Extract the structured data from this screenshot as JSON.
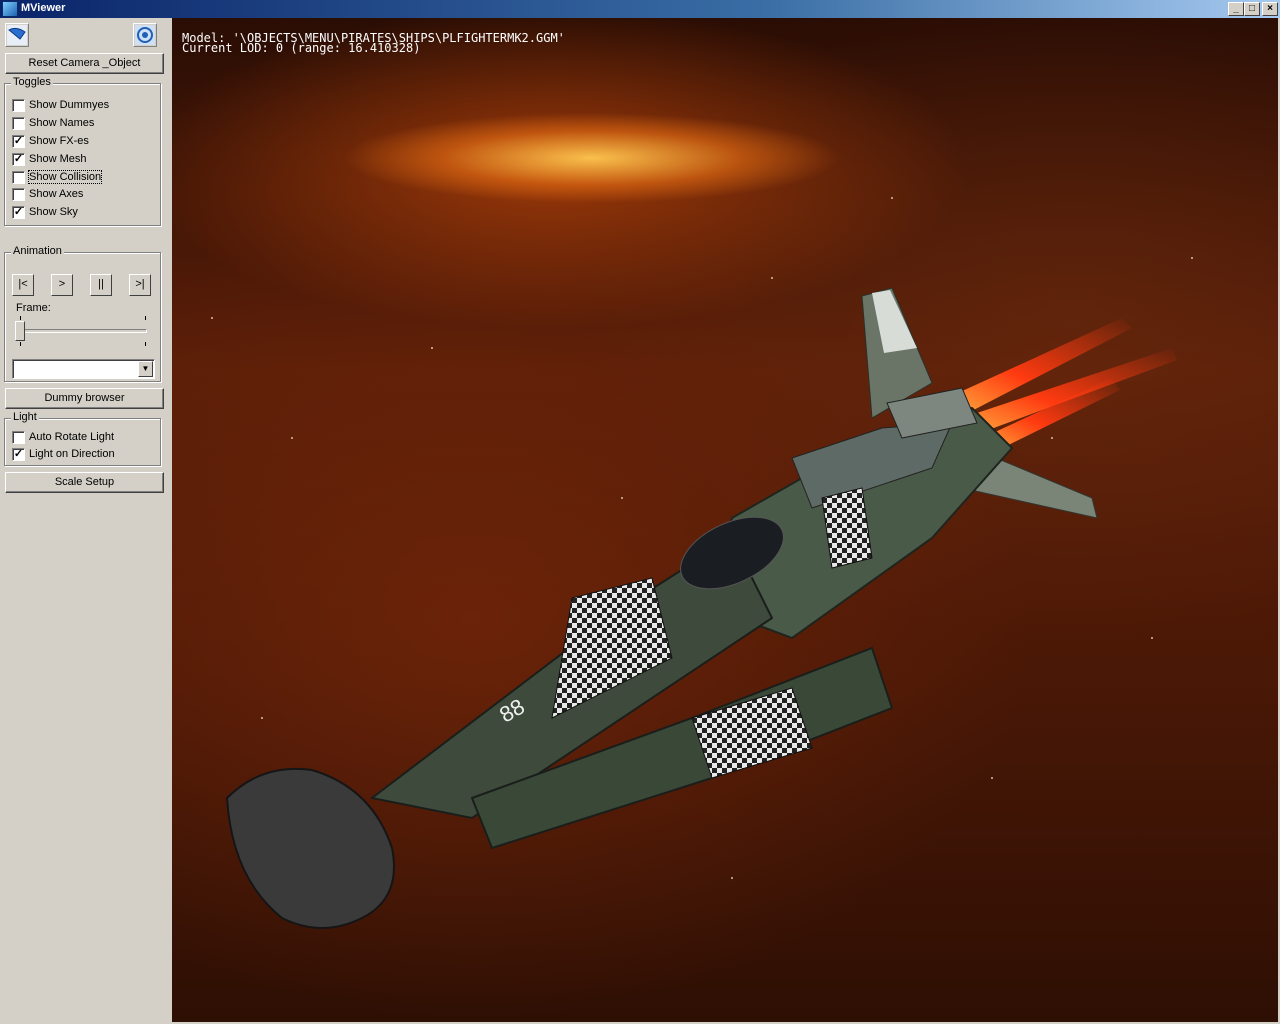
{
  "window": {
    "title": "MViewer",
    "icon": "mviewer-app-icon",
    "controls": {
      "minimize": "_",
      "maximize": "□",
      "close": "×"
    }
  },
  "toolbar": {
    "left_icon": "wing-model-icon",
    "right_icon": "camera-target-icon"
  },
  "panel": {
    "reset_camera_label": "Reset Camera _Object",
    "toggles": {
      "legend": "Toggles",
      "items": [
        {
          "label": "Show Dummyes",
          "checked": false
        },
        {
          "label": "Show Names",
          "checked": false
        },
        {
          "label": "Show FX-es",
          "checked": true
        },
        {
          "label": "Show Mesh",
          "checked": true
        },
        {
          "label": "Show Collision",
          "checked": false
        },
        {
          "label": "Show Axes",
          "checked": false
        },
        {
          "label": "Show Sky",
          "checked": true
        }
      ]
    },
    "animation": {
      "legend": "Animation",
      "buttons": [
        "|<",
        ">",
        "||",
        ">|"
      ],
      "frame_label": "Frame:",
      "frame_value": 0,
      "combo_value": ""
    },
    "dummy_browser_label": "Dummy browser",
    "light": {
      "legend": "Light",
      "items": [
        {
          "label": "Auto Rotate Light",
          "checked": false
        },
        {
          "label": "Light on Direction",
          "checked": true
        }
      ]
    },
    "scale_setup_label": "Scale Setup"
  },
  "viewport": {
    "model_line": "Model: '\\OBJECTS\\MENU\\PIRATES\\SHIPS\\PLFIGHTERMK2.GGM'",
    "lod_line": "Current LOD: 0 (range: 16.410328)",
    "hull_number": "88",
    "colors": {
      "engine_glow": "#ff3a10",
      "hull": "#4a5a48",
      "checker_light": "#e8e8e8",
      "checker_dark": "#222222"
    }
  },
  "check_mark": "✓"
}
